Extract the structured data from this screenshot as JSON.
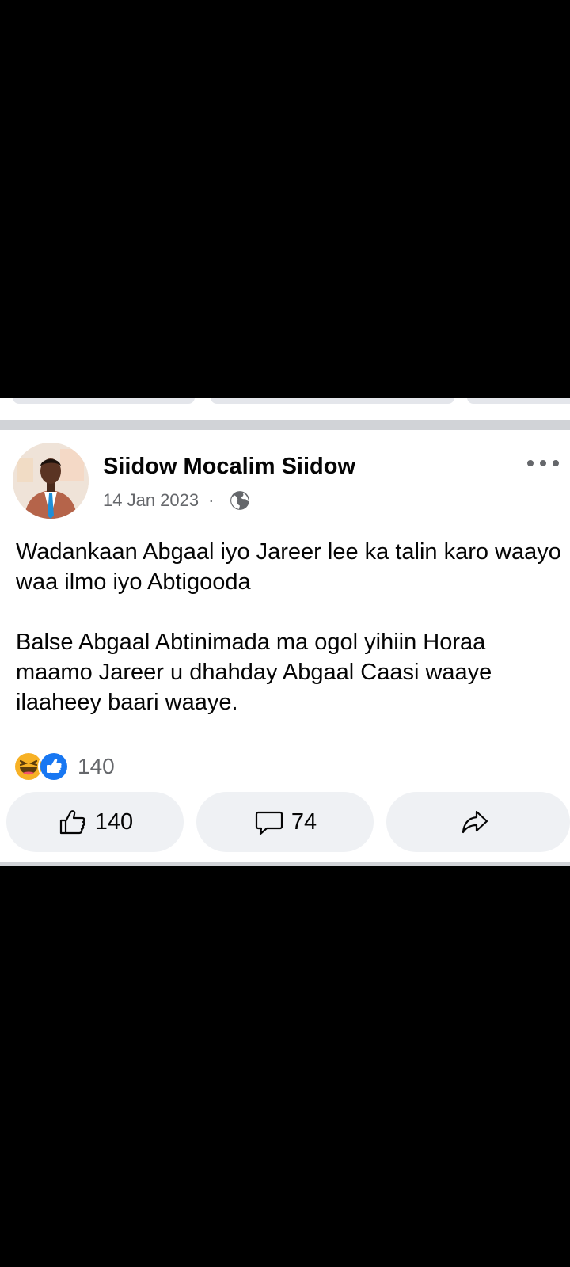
{
  "post": {
    "author": "Siidow Mocalim Siidow",
    "date": "14 Jan 2023",
    "separator": "·",
    "audience_icon": "globe-icon",
    "body": "Wadankaan Abgaal iyo Jareer lee ka talin karo waayo waa ilmo iyo Abtigooda\n\nBalse Abgaal Abtinimada ma ogol yihiin Horaa maamo Jareer u dhahday Abgaal Caasi waaye ilaaheey baari waaye.",
    "reactions": {
      "icons": [
        "haha-reaction-icon",
        "like-reaction-icon"
      ],
      "count": "140"
    },
    "actions": {
      "like_count": "140",
      "comment_count": "74"
    }
  },
  "colors": {
    "like_blue": "#1877f2",
    "haha_yellow": "#f7b125",
    "button_bg": "#eff1f4",
    "secondary_text": "#65676b"
  }
}
